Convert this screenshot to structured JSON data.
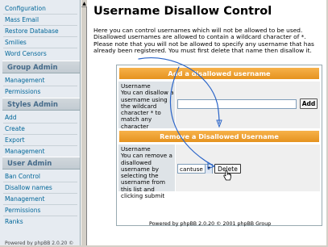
{
  "nav": {
    "items_top": [
      "Configuration",
      "Mass Email",
      "Restore Database",
      "Smilies",
      "Word Censors"
    ],
    "group_admin": {
      "header": "Group Admin",
      "items": [
        "Management",
        "Permissions"
      ]
    },
    "styles_admin": {
      "header": "Styles Admin",
      "items": [
        "Add",
        "Create",
        "Export",
        "Management"
      ]
    },
    "user_admin": {
      "header": "User Admin",
      "items": [
        "Ban Control",
        "Disallow names",
        "Management",
        "Permissions",
        "Ranks"
      ]
    },
    "footer": "Powered by phpBB 2.0.20 ©"
  },
  "main": {
    "title": "Username Disallow Control",
    "description": "Here you can control usernames which will not be allowed to be used. Disallowed usernames are allowed to contain a wildcard character of *. Please note that you will not be allowed to specify any username that has already been registered. You must first delete that name then disallow it."
  },
  "add_section": {
    "header": "Add a disallowed username",
    "label_title": "Username",
    "label_desc": "You can disallow a username using the wildcard character * to match any character",
    "input_value": "",
    "button": "Add"
  },
  "remove_section": {
    "header": "Remove a Disallowed Username",
    "label_title": "Username",
    "label_desc": "You can remove a disallowed username by selecting the username from this list and clicking submit",
    "selected_value": "cantuse",
    "button": "Delete"
  },
  "footer": "Powered by phpBB 2.0.20 © 2001 phpBB Group",
  "colors": {
    "header_orange": "#f0a436",
    "nav_background": "#e6ebf1",
    "nav_link": "#006699",
    "label_cell": "#dee3e7",
    "annotation_arrow": "#2a64c8"
  },
  "icons": {
    "scroll_up": "chevron-up-icon",
    "select_toggle": "chevron-down-icon",
    "pointer": "hand-cursor-icon"
  }
}
